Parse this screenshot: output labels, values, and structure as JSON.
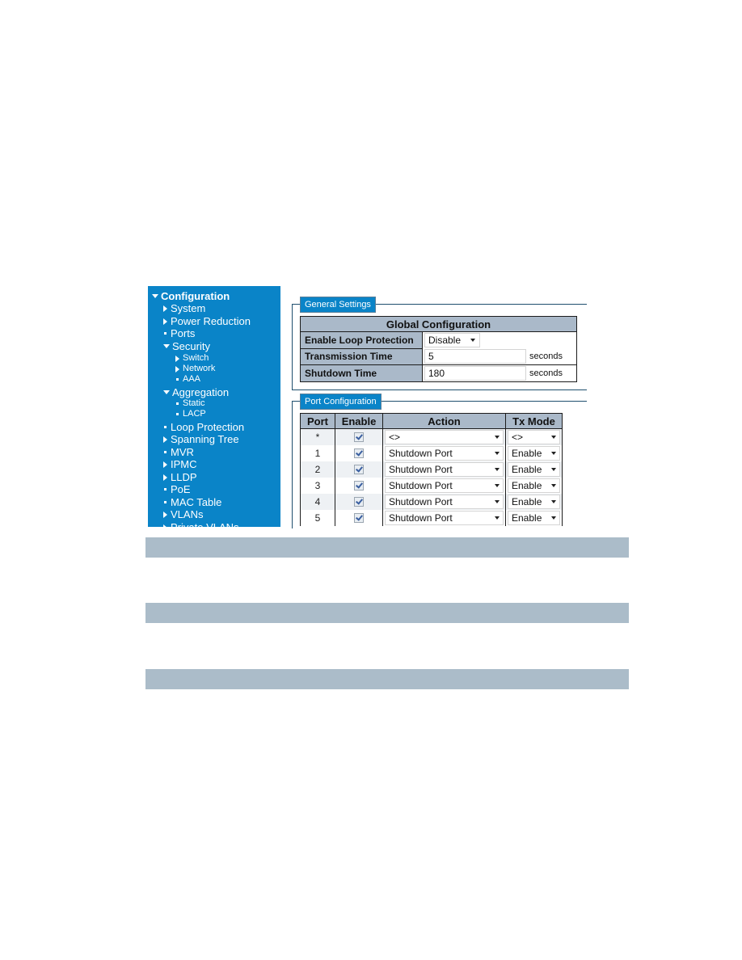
{
  "sidebar": {
    "items": [
      {
        "label": "Configuration",
        "level": 0,
        "icon": "triangle-down-icon"
      },
      {
        "label": "System",
        "level": 1,
        "icon": "triangle-right-icon"
      },
      {
        "label": "Power Reduction",
        "level": 1,
        "icon": "triangle-right-icon"
      },
      {
        "label": "Ports",
        "level": 1,
        "icon": "square-bullet-icon"
      },
      {
        "label": "Security",
        "level": 1,
        "icon": "triangle-down-icon"
      },
      {
        "label": "Switch",
        "level": 2,
        "icon": "triangle-right-icon"
      },
      {
        "label": "Network",
        "level": 2,
        "icon": "triangle-right-icon"
      },
      {
        "label": "AAA",
        "level": 2,
        "icon": "square-bullet-icon"
      },
      {
        "label": "Aggregation",
        "level": 1,
        "icon": "triangle-down-icon"
      },
      {
        "label": "Static",
        "level": 2,
        "icon": "square-bullet-icon"
      },
      {
        "label": "LACP",
        "level": 2,
        "icon": "square-bullet-icon"
      },
      {
        "label": "Loop Protection",
        "level": 1,
        "icon": "square-bullet-icon"
      },
      {
        "label": "Spanning Tree",
        "level": 1,
        "icon": "triangle-right-icon"
      },
      {
        "label": "MVR",
        "level": 1,
        "icon": "square-bullet-icon"
      },
      {
        "label": "IPMC",
        "level": 1,
        "icon": "triangle-right-icon"
      },
      {
        "label": "LLDP",
        "level": 1,
        "icon": "triangle-right-icon"
      },
      {
        "label": "PoE",
        "level": 1,
        "icon": "square-bullet-icon"
      },
      {
        "label": "MAC Table",
        "level": 1,
        "icon": "square-bullet-icon"
      },
      {
        "label": "VLANs",
        "level": 1,
        "icon": "triangle-right-icon"
      },
      {
        "label": "Private VLANs",
        "level": 1,
        "icon": "triangle-right-icon"
      }
    ]
  },
  "general_settings": {
    "legend": "General Settings",
    "table_title": "Global Configuration",
    "rows": [
      {
        "label": "Enable Loop Protection",
        "value": "Disable",
        "type": "select",
        "unit": ""
      },
      {
        "label": "Transmission Time",
        "value": "5",
        "type": "input",
        "unit": "seconds"
      },
      {
        "label": "Shutdown Time",
        "value": "180",
        "type": "input",
        "unit": "seconds"
      }
    ]
  },
  "port_configuration": {
    "legend": "Port Configuration",
    "headers": [
      "Port",
      "Enable",
      "Action",
      "Tx Mode"
    ],
    "rows": [
      {
        "port": "*",
        "enable": true,
        "action": "<>",
        "tx_mode": "<>"
      },
      {
        "port": "1",
        "enable": true,
        "action": "Shutdown Port",
        "tx_mode": "Enable"
      },
      {
        "port": "2",
        "enable": true,
        "action": "Shutdown Port",
        "tx_mode": "Enable"
      },
      {
        "port": "3",
        "enable": true,
        "action": "Shutdown Port",
        "tx_mode": "Enable"
      },
      {
        "port": "4",
        "enable": true,
        "action": "Shutdown Port",
        "tx_mode": "Enable"
      },
      {
        "port": "5",
        "enable": true,
        "action": "Shutdown Port",
        "tx_mode": "Enable"
      }
    ]
  },
  "colors": {
    "sidebar_bg": "#0a84c8",
    "header_bg": "#aab9c9",
    "band_bg": "#abbcc9"
  }
}
